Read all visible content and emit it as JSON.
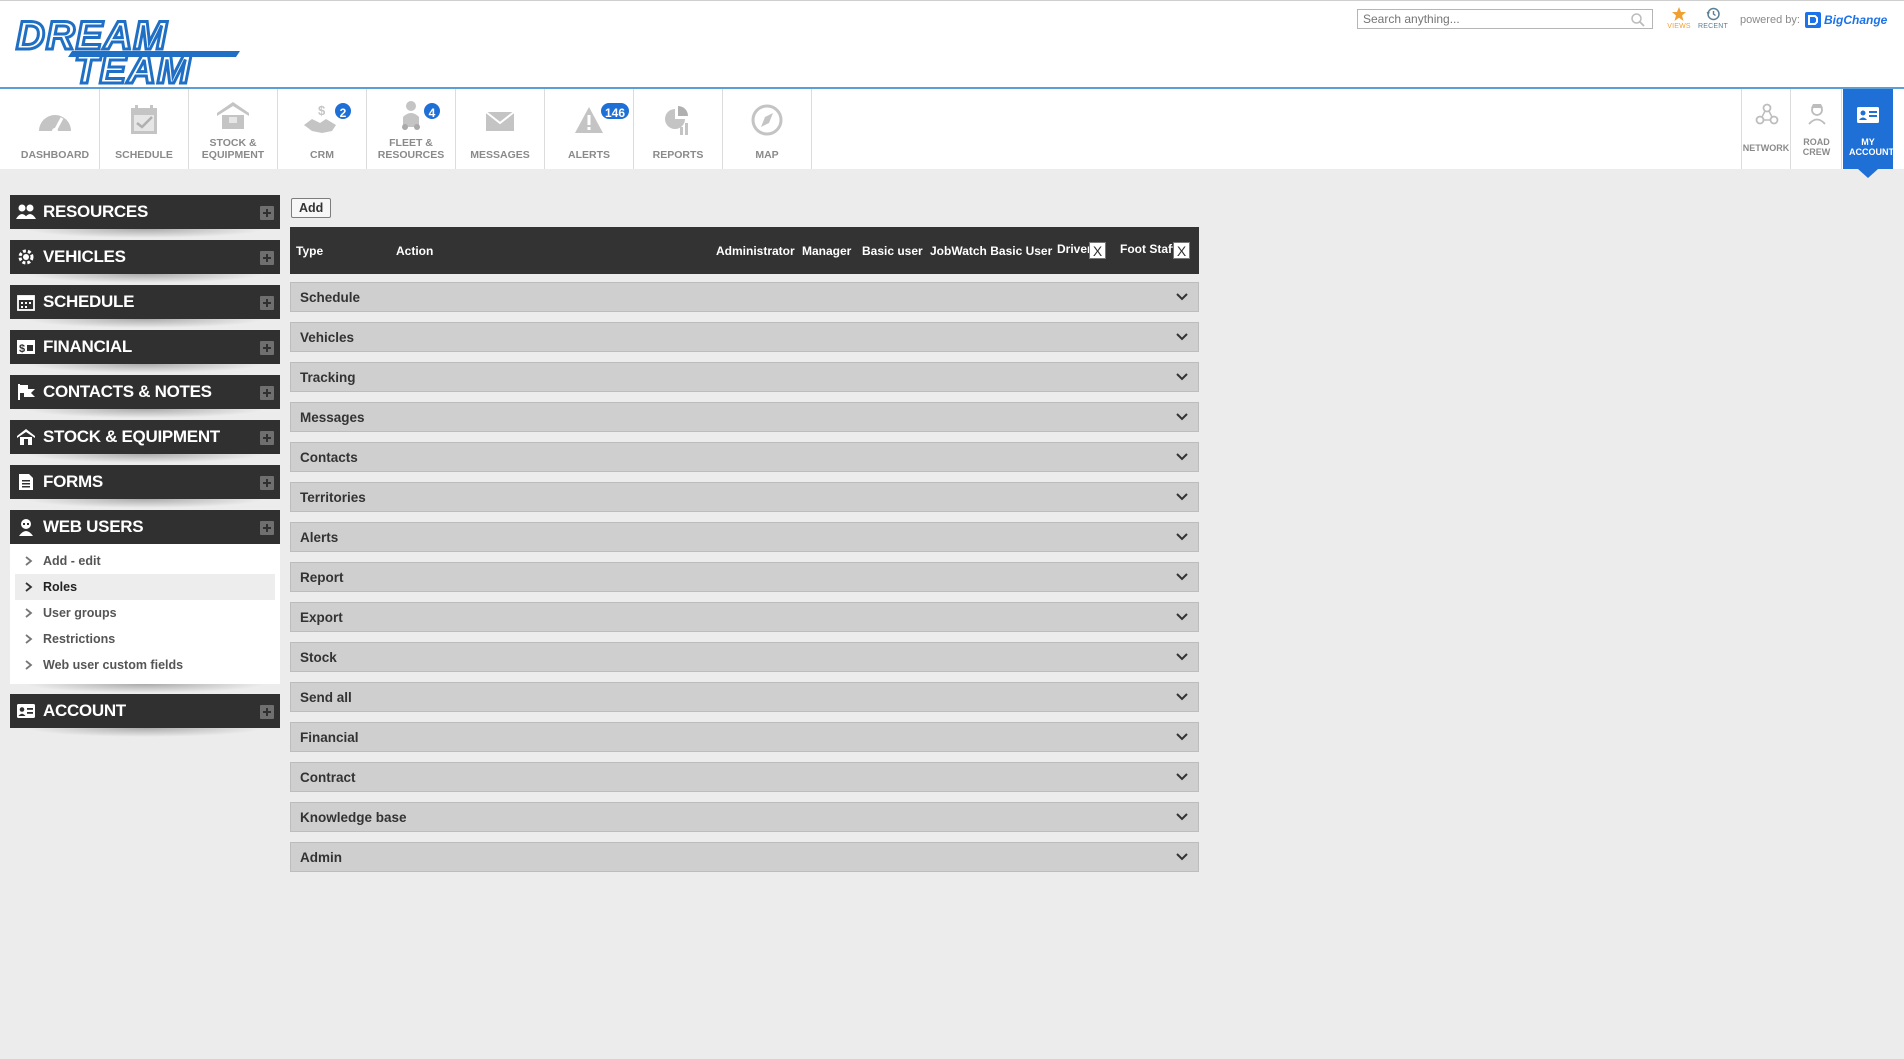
{
  "header": {
    "logo_line1": "DREAM",
    "logo_line2": "TEAM",
    "search_placeholder": "Search anything...",
    "views_label": "VIEWS",
    "recent_label": "RECENT",
    "powered_by": "powered by:",
    "brand": "BigChange",
    "colors": {
      "accent": "#1e6fd6",
      "views": "#f0a030",
      "logo": "#1f6fc4"
    }
  },
  "nav": {
    "items": [
      {
        "label": "DASHBOARD",
        "icon": "speedometer-icon"
      },
      {
        "label": "SCHEDULE",
        "icon": "calendar-icon"
      },
      {
        "label": "STOCK & EQUIPMENT",
        "icon": "warehouse-icon"
      },
      {
        "label": "CRM",
        "icon": "handshake-icon",
        "badge": "2"
      },
      {
        "label": "FLEET & RESOURCES",
        "icon": "driver-icon",
        "badge": "4"
      },
      {
        "label": "MESSAGES",
        "icon": "envelope-icon"
      },
      {
        "label": "ALERTS",
        "icon": "warning-icon",
        "badge": "146"
      },
      {
        "label": "REPORTS",
        "icon": "pie-chart-icon"
      },
      {
        "label": "MAP",
        "icon": "compass-icon"
      }
    ],
    "right": [
      {
        "label": "NETWORK",
        "icon": "network-icon"
      },
      {
        "label": "ROAD CREW",
        "icon": "road-crew-icon"
      },
      {
        "label": "MY ACCOUNT",
        "icon": "id-card-icon",
        "active": true
      }
    ]
  },
  "sidebar": {
    "sections": [
      {
        "label": "RESOURCES",
        "icon": "people-icon"
      },
      {
        "label": "VEHICLES",
        "icon": "gear-icon"
      },
      {
        "label": "SCHEDULE",
        "icon": "calendar-icon"
      },
      {
        "label": "FINANCIAL",
        "icon": "money-icon"
      },
      {
        "label": "CONTACTS & NOTES",
        "icon": "flag-icon"
      },
      {
        "label": "STOCK & EQUIPMENT",
        "icon": "warehouse-icon"
      },
      {
        "label": "FORMS",
        "icon": "document-icon"
      },
      {
        "label": "WEB USERS",
        "icon": "user-icon"
      },
      {
        "label": "ACCOUNT",
        "icon": "id-card-icon"
      }
    ],
    "web_users_items": [
      {
        "label": "Add - edit"
      },
      {
        "label": "Roles",
        "selected": true
      },
      {
        "label": "User groups"
      },
      {
        "label": "Restrictions"
      },
      {
        "label": "Web user custom fields"
      }
    ]
  },
  "main": {
    "add_label": "Add",
    "columns": {
      "type": "Type",
      "action": "Action",
      "roles": [
        "Administrator",
        "Manager",
        "Basic user",
        "JobWatch Basic User",
        "Driver",
        "Foot Staff"
      ],
      "remove_label": "X"
    },
    "rows": [
      "Schedule",
      "Vehicles",
      "Tracking",
      "Messages",
      "Contacts",
      "Territories",
      "Alerts",
      "Report",
      "Export",
      "Stock",
      "Send all",
      "Financial",
      "Contract",
      "Knowledge base",
      "Admin"
    ]
  }
}
